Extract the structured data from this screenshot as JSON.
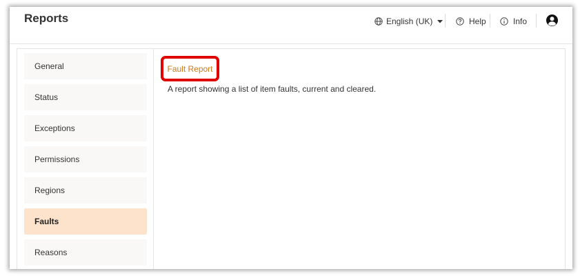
{
  "header": {
    "title": "Reports",
    "language": {
      "label": "English (UK)",
      "icon": "globe-icon"
    },
    "help": {
      "label": "Help",
      "icon": "question-circle-icon"
    },
    "info": {
      "label": "Info",
      "icon": "info-circle-icon"
    },
    "user": {
      "icon": "user-avatar-icon"
    }
  },
  "sidebar": {
    "items": [
      {
        "label": "General",
        "active": false
      },
      {
        "label": "Status",
        "active": false
      },
      {
        "label": "Exceptions",
        "active": false
      },
      {
        "label": "Permissions",
        "active": false
      },
      {
        "label": "Regions",
        "active": false
      },
      {
        "label": "Faults",
        "active": true
      },
      {
        "label": "Reasons",
        "active": false
      }
    ]
  },
  "main": {
    "reports": [
      {
        "title": "Fault Report",
        "description": "A report showing a list of item faults, current and cleared."
      }
    ]
  },
  "colors": {
    "accent_link": "#cc7a1a",
    "active_item_bg": "#fde3cb",
    "highlight_border": "#e00000"
  }
}
